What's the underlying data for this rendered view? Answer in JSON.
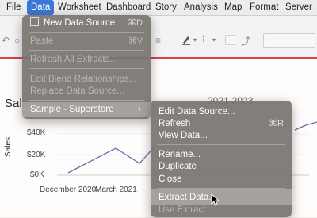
{
  "menubar": {
    "items": [
      "File",
      "Data",
      "Worksheet",
      "Dashboard",
      "Story",
      "Analysis",
      "Map",
      "Format",
      "Server"
    ],
    "active_index": 1
  },
  "sheet": {
    "title": "Sale",
    "hidden_title_fragment": "2021-2023",
    "y_axis_label": "Sales",
    "y_ticks": [
      "$40K",
      "$20K",
      "$0K"
    ],
    "x_ticks": [
      "December 2020",
      "March 2021"
    ],
    "line_color": "#6a6aa8"
  },
  "data_menu": {
    "items": [
      {
        "label": "New Data Source",
        "shortcut": "⌘D",
        "enabled": true,
        "icon": "new-datasource-icon"
      },
      {
        "label": "Paste",
        "shortcut": "⌘V",
        "enabled": false
      },
      {
        "label": "Refresh All Extracts...",
        "enabled": false
      },
      {
        "label": "Edit Blend Relationships...",
        "enabled": false
      },
      {
        "label": "Replace Data Source...",
        "enabled": false
      },
      {
        "label": "Sample - Superstore",
        "enabled": true,
        "submenu": true
      }
    ]
  },
  "submenu": {
    "items": [
      {
        "label": "Edit Data Source...",
        "enabled": true
      },
      {
        "label": "Refresh",
        "shortcut": "⌘R",
        "enabled": true
      },
      {
        "label": "View Data...",
        "enabled": true
      },
      {
        "label": "Rename...",
        "enabled": true
      },
      {
        "label": "Duplicate",
        "enabled": true
      },
      {
        "label": "Close",
        "enabled": true
      },
      {
        "label": "Extract Data...",
        "enabled": true
      },
      {
        "label": "Use Extract",
        "enabled": false
      }
    ]
  },
  "colors": {
    "accent": "#3a77d9",
    "toolbar_border": "#d64545",
    "menu_bg": "#787470"
  }
}
